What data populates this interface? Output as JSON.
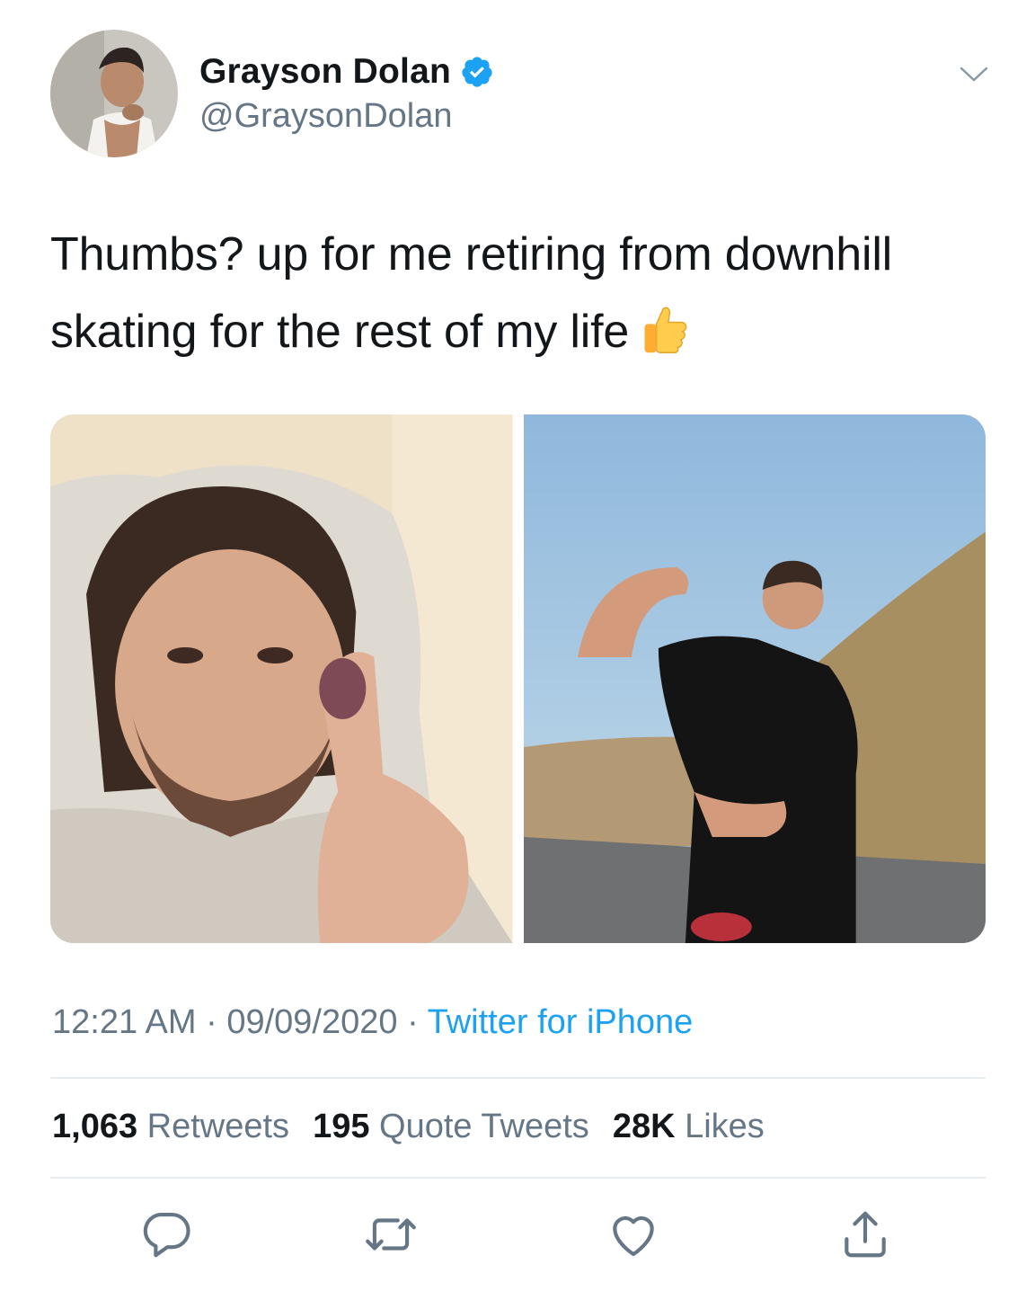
{
  "author": {
    "display_name": "Grayson Dolan",
    "handle": "@GraysonDolan",
    "verified": true
  },
  "tweet": {
    "text": "Thumbs? up for me retiring from downhill skating for the rest of my life",
    "emoji": "thumbs-up",
    "photos_count": 2
  },
  "meta": {
    "time": "12:21 AM",
    "separator": "·",
    "date": "09/09/2020",
    "source": "Twitter for iPhone"
  },
  "stats": {
    "retweets_count": "1,063",
    "retweets_label": "Retweets",
    "quotes_count": "195",
    "quotes_label": "Quote Tweets",
    "likes_count": "28K",
    "likes_label": "Likes"
  },
  "colors": {
    "accent": "#1da1f2",
    "text_secondary": "#657786",
    "text_primary": "#14171a",
    "divider": "#e6ecf0"
  }
}
